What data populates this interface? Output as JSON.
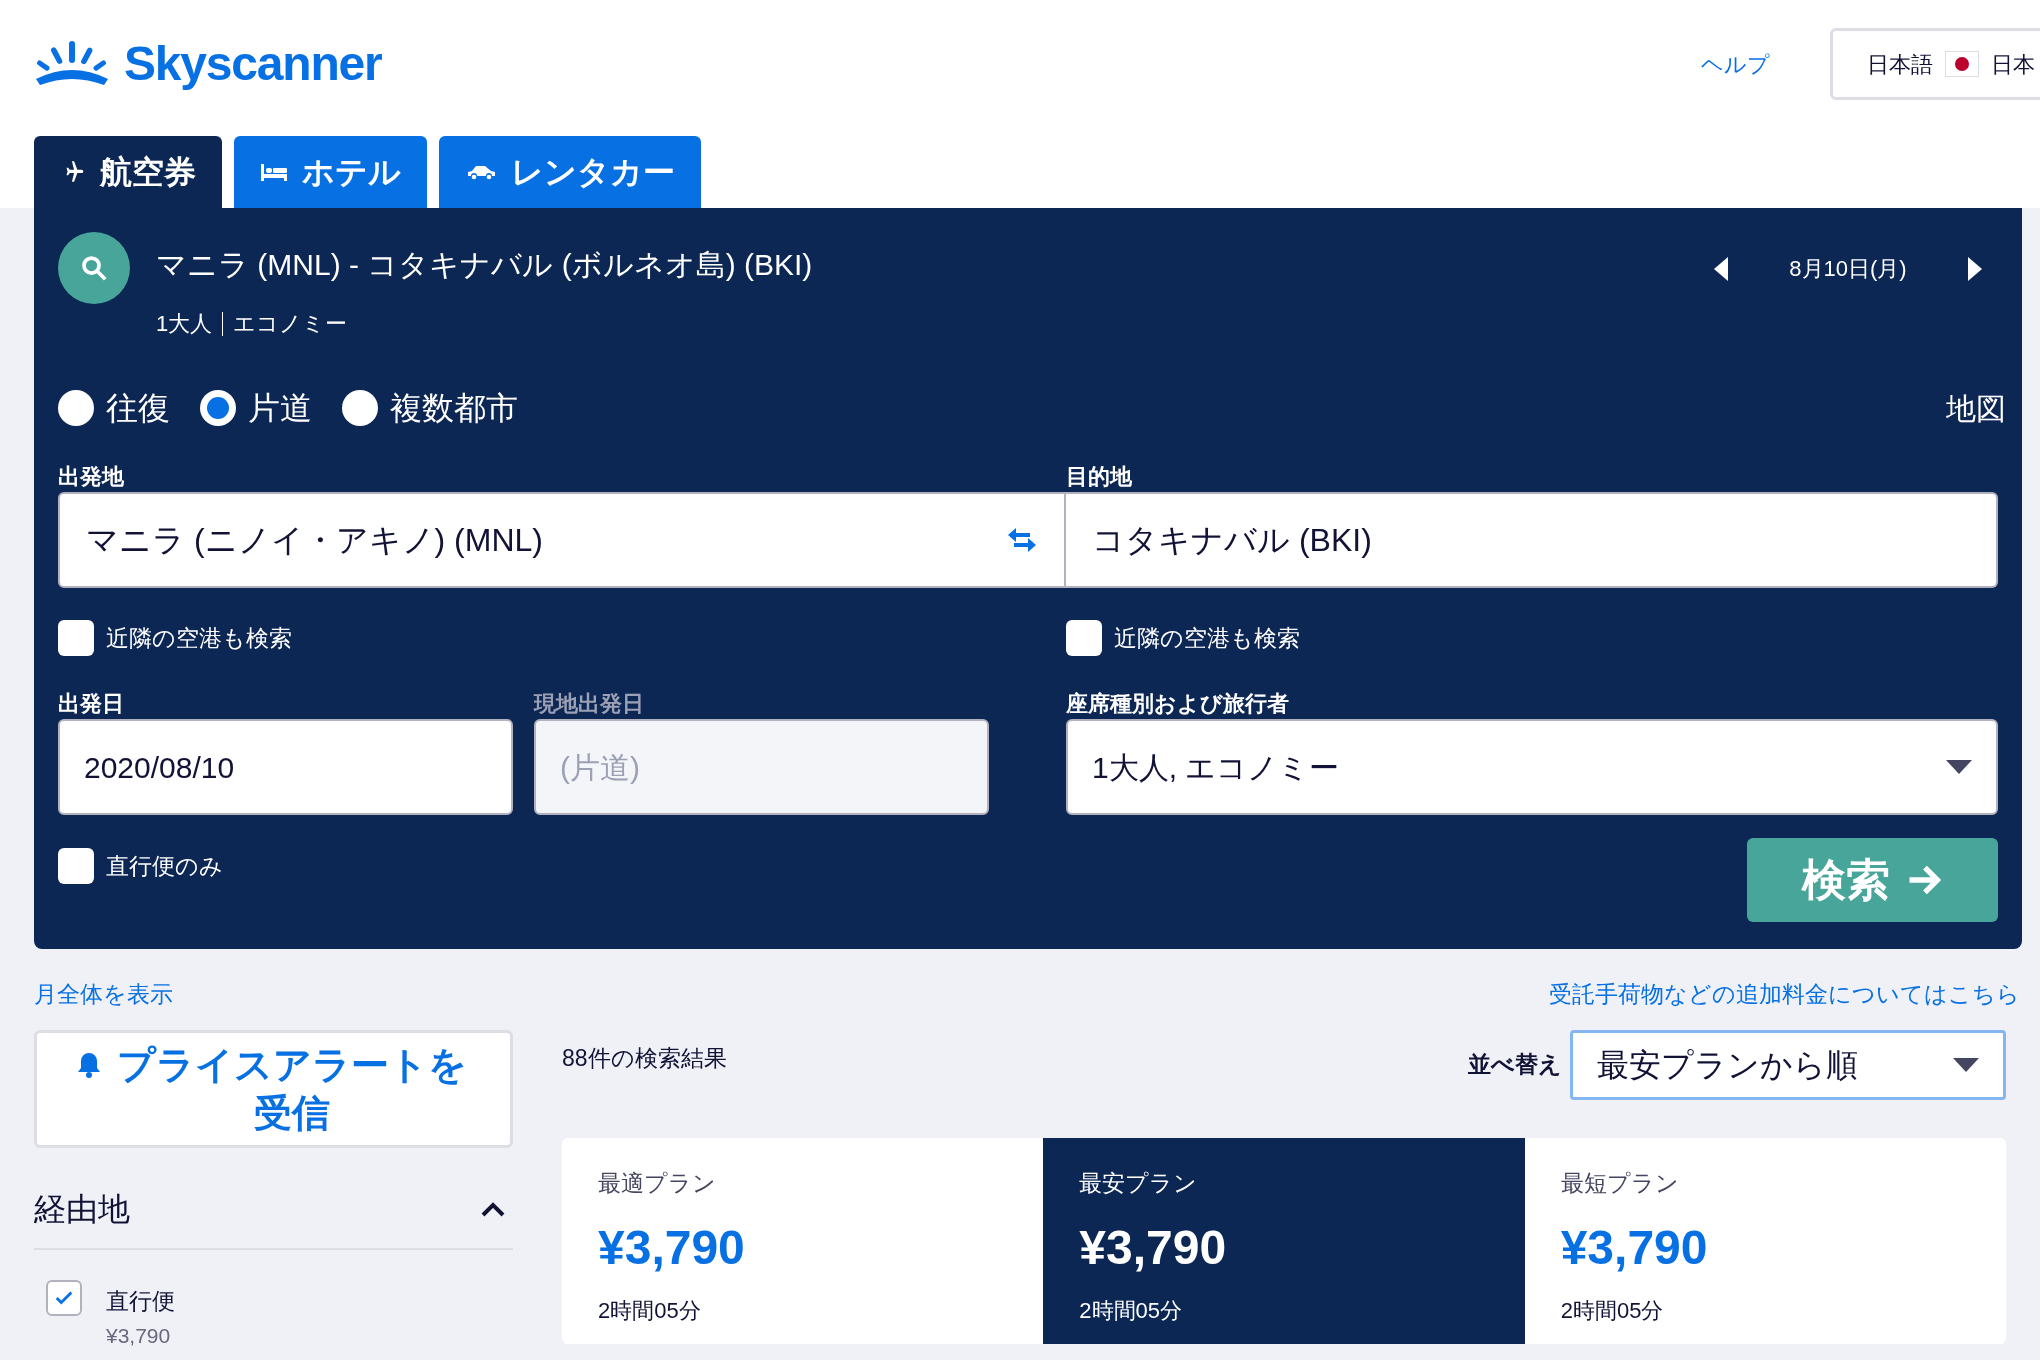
{
  "header": {
    "logo": "Skyscanner",
    "help_link": "ヘルプ",
    "locale_button": {
      "language": "日本語",
      "region": "日本"
    }
  },
  "tabs": [
    {
      "label": "航空券",
      "kind": "plane",
      "selected": true
    },
    {
      "label": "ホテル",
      "kind": "bed",
      "selected": false
    },
    {
      "label": "レンタカー",
      "kind": "car",
      "selected": false
    }
  ],
  "search_summary": {
    "route": "マニラ (MNL) - コタキナバル (ボルネオ島) (BKI)",
    "passengers": "1大人",
    "cabin": "エコノミー",
    "date": "8月10日(月)"
  },
  "trip_types": [
    {
      "label": "往復",
      "selected": false
    },
    {
      "label": "片道",
      "selected": true
    },
    {
      "label": "複数都市",
      "selected": false
    }
  ],
  "map_link": "地図",
  "origin": {
    "label": "出発地",
    "value": "マニラ (ニノイ・アキノ) (MNL)",
    "nearby": {
      "label": "近隣の空港も検索",
      "checked": false
    }
  },
  "destination": {
    "label": "目的地",
    "value": "コタキナバル (BKI)",
    "nearby": {
      "label": "近隣の空港も検索",
      "checked": false
    }
  },
  "depart_date": {
    "label": "出発日",
    "value": "2020/08/10"
  },
  "return_date": {
    "label": "現地出発日",
    "placeholder": "(片道)",
    "disabled": true
  },
  "cabin_travellers": {
    "label": "座席種別および旅行者",
    "value": "1大人, エコノミー"
  },
  "direct_only": {
    "label": "直行便のみ",
    "checked": false
  },
  "search_button": "検索",
  "month_link": "月全体を表示",
  "fees_link": "受託手荷物などの追加料金についてはこちら",
  "price_alert_button": "プライスアラートを受信",
  "result_count": "88件の検索結果",
  "sort": {
    "label": "並べ替え",
    "value": "最安プランから順"
  },
  "sort_cards": [
    {
      "title": "最適プラン",
      "price": "¥3,790",
      "duration": "2時間05分",
      "selected": false
    },
    {
      "title": "最安プラン",
      "price": "¥3,790",
      "duration": "2時間05分",
      "selected": true
    },
    {
      "title": "最短プラン",
      "price": "¥3,790",
      "duration": "2時間05分",
      "selected": false
    }
  ],
  "filters": {
    "title": "経由地",
    "expanded": true,
    "options": [
      {
        "label": "直行便",
        "price": "¥3,790",
        "checked": true
      }
    ]
  }
}
